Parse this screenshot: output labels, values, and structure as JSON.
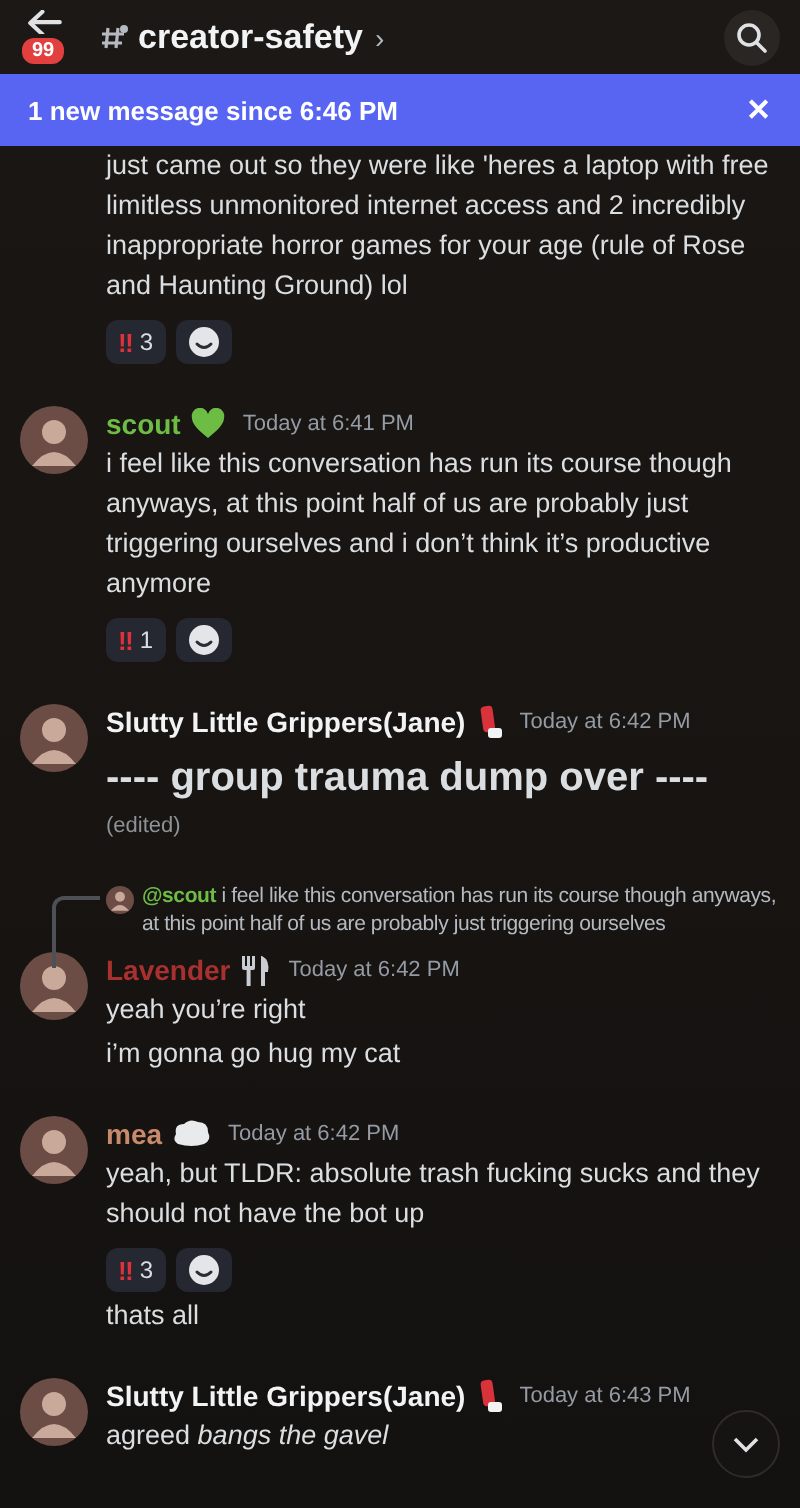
{
  "header": {
    "badge": "99",
    "channel": "creator-safety",
    "chevron": "›"
  },
  "banner": {
    "text": "1 new message since 6:46 PM",
    "close": "✕"
  },
  "messages": [
    {
      "kind": "continuation",
      "items": [
        {
          "kind": "text",
          "text": "just came out so they were like 'heres a laptop with free  limitless unmonitored internet access and 2 incredibly inappropriate horror games for your age (rule of Rose and Haunting Ground) lol",
          "reactions": [
            {
              "emoji": "‼",
              "count": "3"
            }
          ]
        }
      ]
    },
    {
      "kind": "group",
      "author": "scout",
      "color": "#6dbd45",
      "role_badge": {
        "kind": "heart"
      },
      "time": "Today at 6:41 PM",
      "items": [
        {
          "kind": "text",
          "text": "i feel like this conversation has run its course though anyways, at this point half of us are probably just triggering ourselves and i don’t think it’s productive anymore",
          "reactions": [
            {
              "emoji": "‼",
              "count": "1"
            }
          ]
        }
      ]
    },
    {
      "kind": "group",
      "author": "Slutty Little Grippers(Jane)",
      "color": "#f2f3f5",
      "role_badge": {
        "kind": "inhaler"
      },
      "time": "Today at 6:42 PM",
      "items": [
        {
          "kind": "heading",
          "text": "---- group trauma dump over ----",
          "edited": "(edited)"
        }
      ]
    },
    {
      "kind": "group",
      "author": "Lavender",
      "color": "#a8312f",
      "role_badge": {
        "kind": "utensils"
      },
      "time": "Today at 6:42 PM",
      "reply": {
        "mention": "@scout",
        "text": "i feel like this conversation has run its course though anyways, at this point half of us are probably just triggering ourselves"
      },
      "items": [
        {
          "kind": "text",
          "text": "yeah you’re right"
        },
        {
          "kind": "text",
          "text": "i’m gonna go hug my cat"
        }
      ]
    },
    {
      "kind": "group",
      "author": "mea",
      "color": "#c98a6c",
      "role_badge": {
        "kind": "cloud"
      },
      "time": "Today at 6:42 PM",
      "items": [
        {
          "kind": "text",
          "text": "yeah, but TLDR: absolute trash fucking sucks and they should not have the bot up",
          "reactions": [
            {
              "emoji": "‼",
              "count": "3"
            }
          ]
        },
        {
          "kind": "text",
          "text": "thats all"
        }
      ]
    },
    {
      "kind": "group",
      "author": "Slutty Little Grippers(Jane)",
      "color": "#f2f3f5",
      "role_badge": {
        "kind": "inhaler"
      },
      "time": "Today at 6:43 PM",
      "items": [
        {
          "kind": "text",
          "text": "agreed *bangs the gavel*"
        }
      ]
    }
  ]
}
